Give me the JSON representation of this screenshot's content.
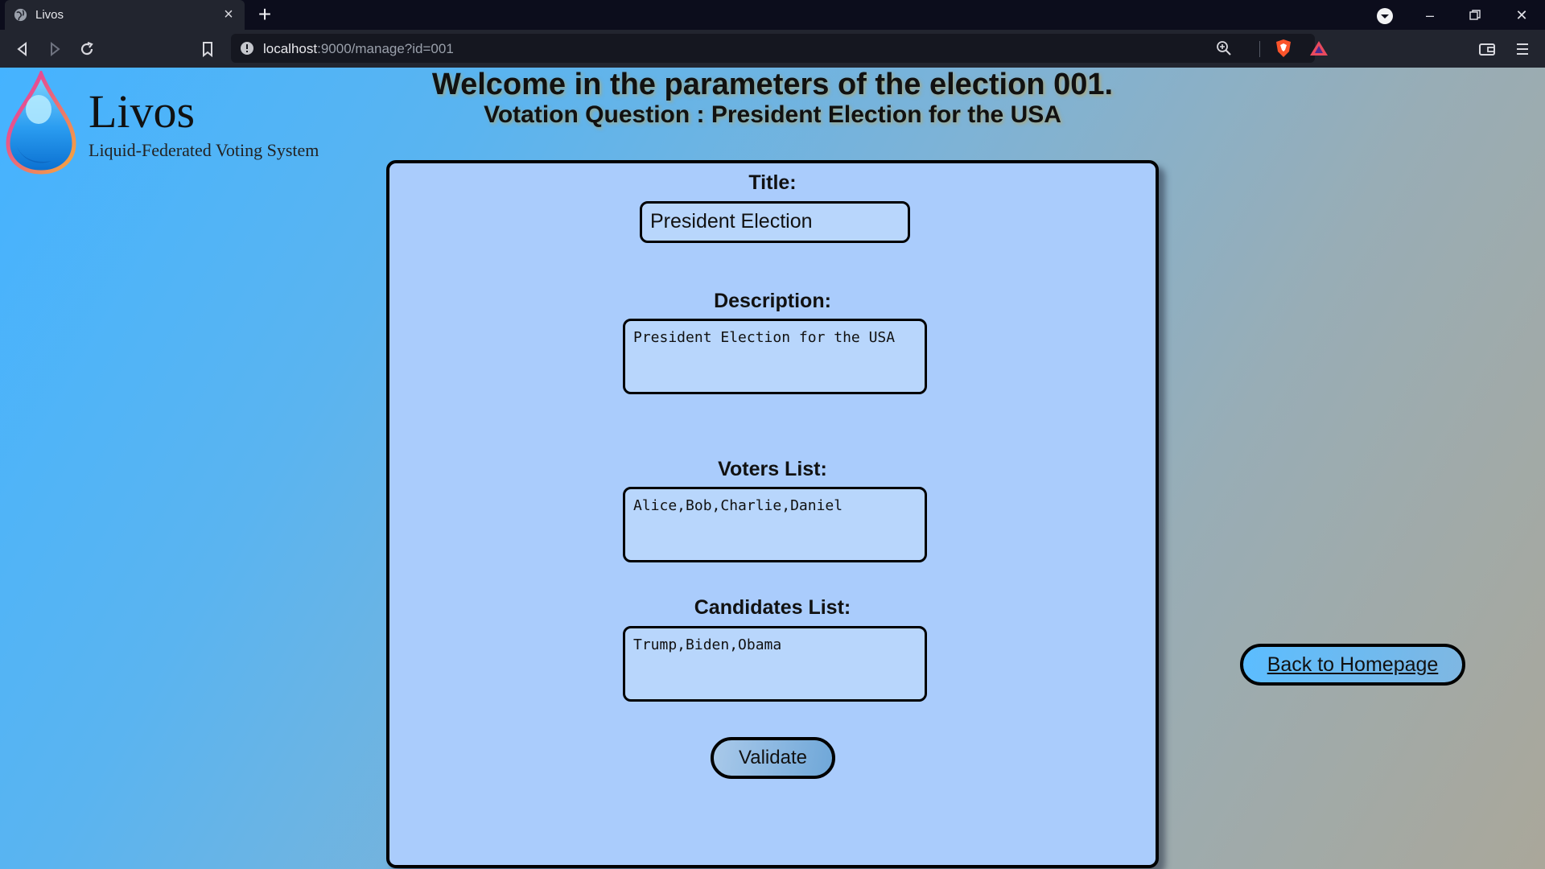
{
  "browser": {
    "tab_title": "Livos",
    "url_host": "localhost",
    "url_rest": ":9000/manage?id=001"
  },
  "logo": {
    "name": "Livos",
    "tagline": "Liquid-Federated Voting System"
  },
  "heading": {
    "title": "Welcome in the parameters of the election 001.",
    "subtitle": "Votation Question : President Election for the USA"
  },
  "form": {
    "title_label": "Title:",
    "title_value": "President Election",
    "description_label": "Description:",
    "description_value": "President Election for the USA",
    "voters_label": "Voters List:",
    "voters_value": "Alice,Bob,Charlie,Daniel",
    "candidates_label": "Candidates List:",
    "candidates_value": "Trump,Biden,Obama",
    "validate_label": "Validate"
  },
  "nav": {
    "back_label": "Back to Homepage"
  },
  "colors": {
    "panel_bg": "#aaccfc",
    "page_gradient_start": "#45b3ff",
    "page_gradient_end": "#aaa79a",
    "chrome_bg": "#22252f"
  }
}
